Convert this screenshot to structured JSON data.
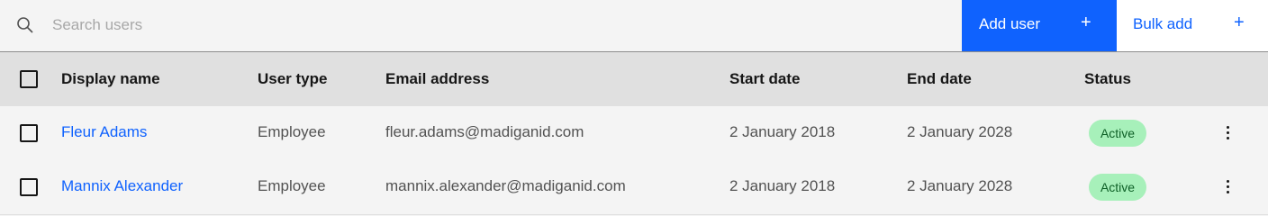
{
  "search": {
    "placeholder": "Search users",
    "value": "",
    "icon": "search-icon"
  },
  "actions": {
    "add_user": {
      "label": "Add user",
      "icon": "+"
    },
    "bulk_add": {
      "label": "Bulk add",
      "icon": "+"
    }
  },
  "table": {
    "columns": [
      "Display name",
      "User type",
      "Email address",
      "Start date",
      "End date",
      "Status"
    ],
    "rows": [
      {
        "display_name": "Fleur Adams",
        "user_type": "Employee",
        "email": "fleur.adams@madiganid.com",
        "start_date": "2 January 2018",
        "end_date": "2 January 2028",
        "status": "Active"
      },
      {
        "display_name": "Mannix Alexander",
        "user_type": "Employee",
        "email": "mannix.alexander@madiganid.com",
        "start_date": "2 January 2018",
        "end_date": "2 January 2028",
        "status": "Active"
      }
    ]
  },
  "colors": {
    "primary": "#0f62fe",
    "status_active_bg": "#a7f0ba",
    "status_active_text": "#0e6027",
    "header_bg": "#e0e0e0",
    "row_bg": "#f4f4f4"
  }
}
